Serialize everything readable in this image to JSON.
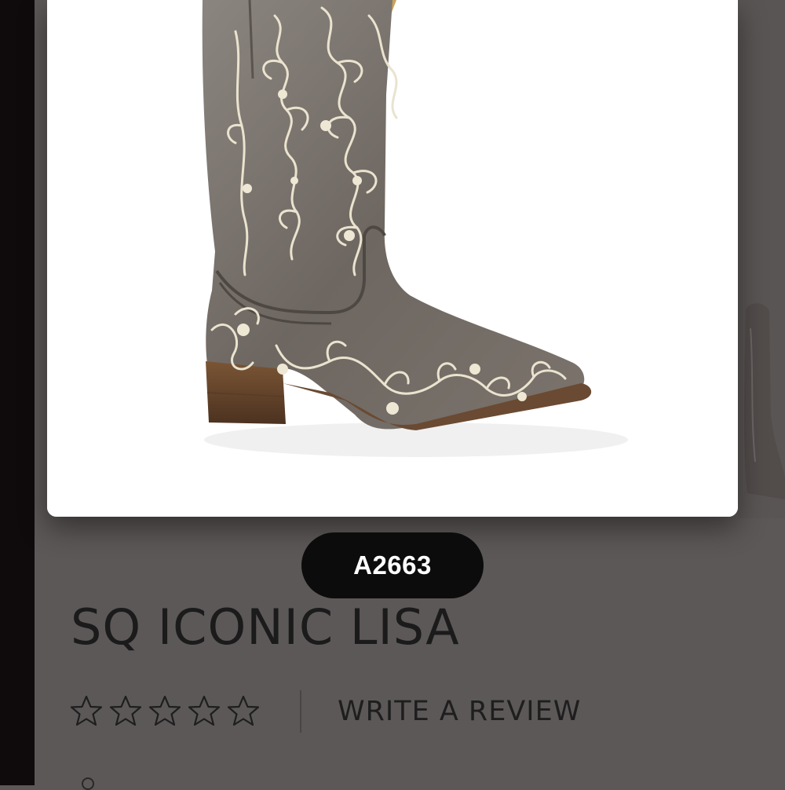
{
  "product": {
    "image_alt": "Boot",
    "sku": "A2663",
    "title": "SQ ICONIC LISA"
  },
  "rating": {
    "stars_filled": 0,
    "stars_total": 5,
    "write_review_label": "WRITE A REVIEW"
  },
  "colors": {
    "background": "#5d5858",
    "left_strip": "#0f0a0b",
    "pill": "#0d0c0c",
    "pill_text": "#ffffff",
    "title_text": "#1b1b1b"
  },
  "icons": {
    "star": "star-outline-icon",
    "partial": "circle-icon"
  }
}
